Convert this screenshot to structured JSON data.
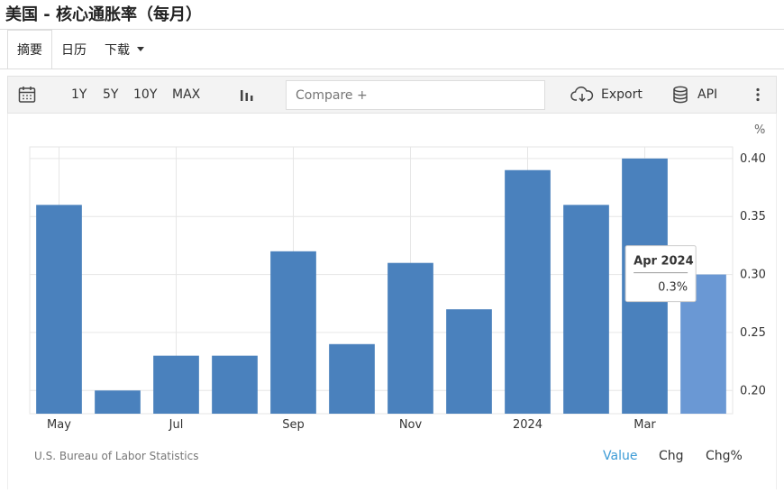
{
  "title": "美国 - 核心通胀率（每月）",
  "tabs": [
    {
      "label": "摘要",
      "active": true
    },
    {
      "label": "日历",
      "active": false
    },
    {
      "label": "下载",
      "active": false,
      "dropdown": true
    }
  ],
  "toolbar": {
    "ranges": [
      "1Y",
      "5Y",
      "10Y",
      "MAX"
    ],
    "compare_placeholder": "Compare +",
    "export_label": "Export",
    "api_label": "API",
    "icons": [
      "calendar-icon",
      "bar-chart-icon",
      "cloud-download-icon",
      "database-icon",
      "more-vertical-icon"
    ]
  },
  "chart_data": {
    "type": "bar",
    "unit": "%",
    "categories": [
      "May 2023",
      "Jun 2023",
      "Jul 2023",
      "Aug 2023",
      "Sep 2023",
      "Oct 2023",
      "Nov 2023",
      "Dec 2023",
      "Jan 2024",
      "Feb 2024",
      "Mar 2024",
      "Apr 2024"
    ],
    "values": [
      0.36,
      0.2,
      0.23,
      0.23,
      0.32,
      0.24,
      0.31,
      0.27,
      0.39,
      0.36,
      0.4,
      0.3
    ],
    "x_tick_labels": [
      {
        "index": 0,
        "label": "May"
      },
      {
        "index": 2,
        "label": "Jul"
      },
      {
        "index": 4,
        "label": "Sep"
      },
      {
        "index": 6,
        "label": "Nov"
      },
      {
        "index": 8,
        "label": "2024"
      },
      {
        "index": 10,
        "label": "Mar"
      }
    ],
    "y_ticks": [
      "0.20",
      "0.25",
      "0.30",
      "0.35",
      "0.40"
    ],
    "ylim": [
      0.18,
      0.41
    ],
    "grid": true,
    "highlight_index": 11,
    "tooltip": {
      "title": "Apr 2024",
      "value": "0.3%"
    },
    "colors": {
      "bar": "#4a81bd",
      "highlight": "#6a98d4",
      "grid": "#e6e6e6"
    }
  },
  "footer": {
    "source": "U.S. Bureau of Labor Statistics",
    "view_tabs": [
      {
        "label": "Value",
        "active": true
      },
      {
        "label": "Chg",
        "active": false
      },
      {
        "label": "Chg%",
        "active": false
      }
    ],
    "active_color": "#3c9bd6"
  }
}
